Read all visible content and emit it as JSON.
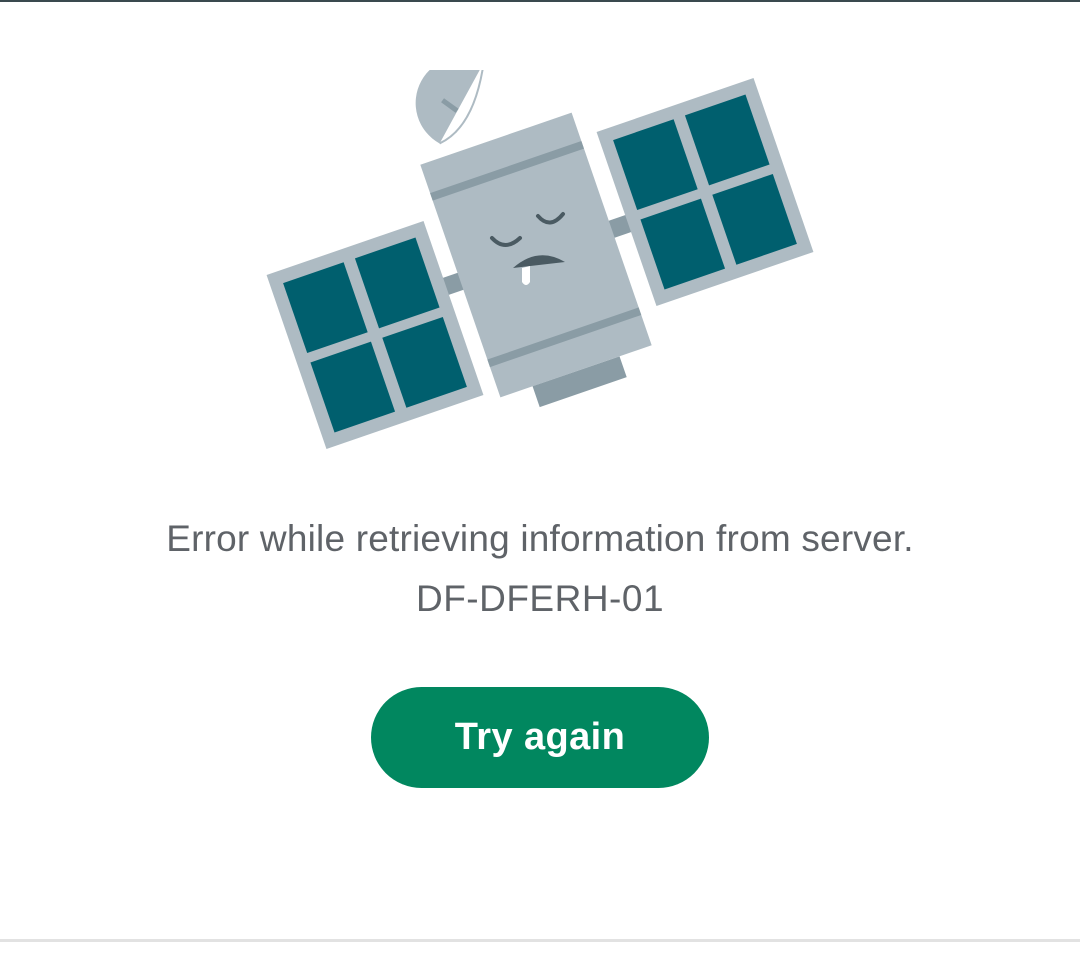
{
  "illustration": {
    "icon": "sleeping-satellite-icon",
    "colors": {
      "body": "#aebbc3",
      "stripe": "#8a9ca5",
      "panel_frame": "#aebbc3",
      "panel_cell": "#005f6e",
      "face": "#4a5a62"
    }
  },
  "error": {
    "message": "Error while retrieving information from server.",
    "code": "DF-DFERH-01"
  },
  "actions": {
    "retry_label": "Try again",
    "retry_color": "#01875f"
  }
}
